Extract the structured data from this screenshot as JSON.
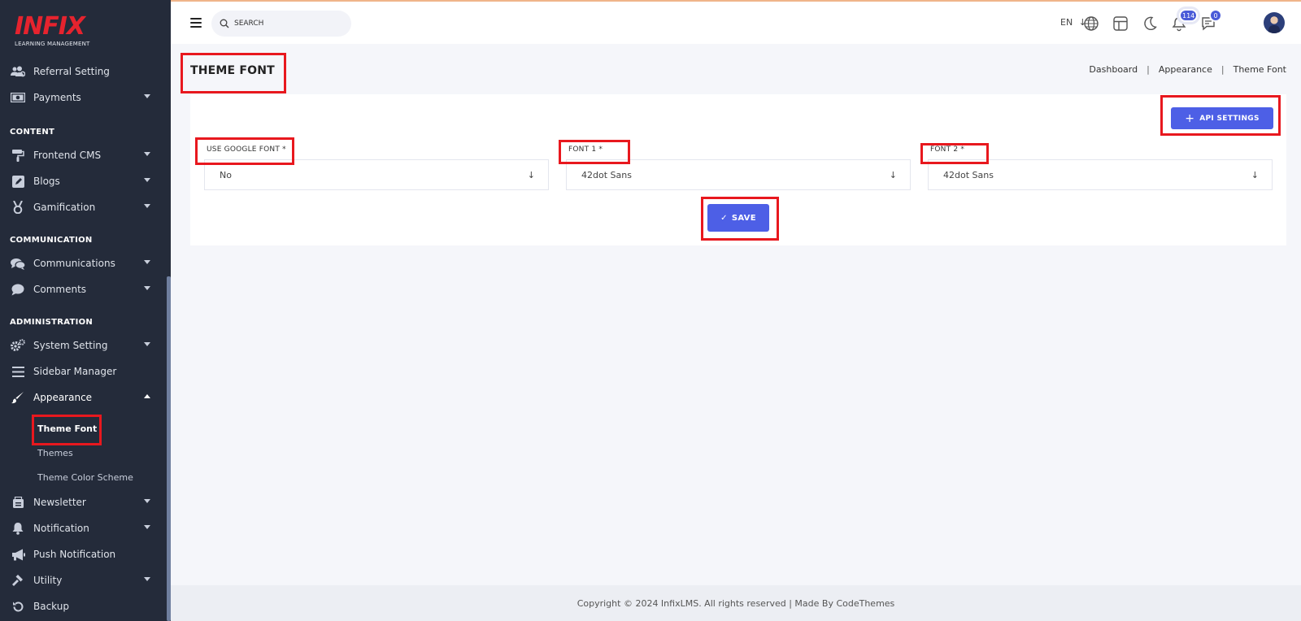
{
  "logo": {
    "word": "INFIX",
    "subtitle": "LEARNING MANAGEMENT"
  },
  "sidebar": {
    "top_items": [
      {
        "label": "Referral Setting"
      },
      {
        "label": "Payments"
      }
    ],
    "sections": {
      "content": "CONTENT",
      "communication": "COMMUNICATION",
      "administration": "ADMINISTRATION"
    },
    "content_items": [
      {
        "label": "Frontend CMS"
      },
      {
        "label": "Blogs"
      },
      {
        "label": "Gamification"
      }
    ],
    "communication_items": [
      {
        "label": "Communications"
      },
      {
        "label": "Comments"
      }
    ],
    "admin_items": [
      {
        "label": "System Setting"
      },
      {
        "label": "Sidebar Manager"
      },
      {
        "label": "Appearance"
      }
    ],
    "appearance_sub": [
      {
        "label": "Theme Font"
      },
      {
        "label": "Themes"
      },
      {
        "label": "Theme Color Scheme"
      }
    ],
    "bottom_items": [
      {
        "label": "Newsletter"
      },
      {
        "label": "Notification"
      },
      {
        "label": "Push Notification"
      },
      {
        "label": "Utility"
      },
      {
        "label": "Backup"
      }
    ]
  },
  "topbar": {
    "search_placeholder": "SEARCH",
    "language": "EN",
    "notification_count": "114",
    "message_count": "0"
  },
  "page": {
    "title": "THEME FONT",
    "breadcrumb": [
      "Dashboard",
      "Appearance",
      "Theme Font"
    ]
  },
  "form": {
    "api_button": "API SETTINGS",
    "fields": [
      {
        "label": "USE GOOGLE FONT *",
        "value": "No"
      },
      {
        "label": "FONT 1 *",
        "value": "42dot Sans"
      },
      {
        "label": "FONT 2 *",
        "value": "42dot Sans"
      }
    ],
    "save_button": "SAVE"
  },
  "footer": {
    "text": "Copyright © 2024 InfixLMS. All rights reserved | Made By CodeThemes"
  },
  "colors": {
    "accent": "#4d5fe6",
    "sidebar": "#242b3a",
    "highlight": "#e8181e",
    "logo": "#e6232e"
  }
}
